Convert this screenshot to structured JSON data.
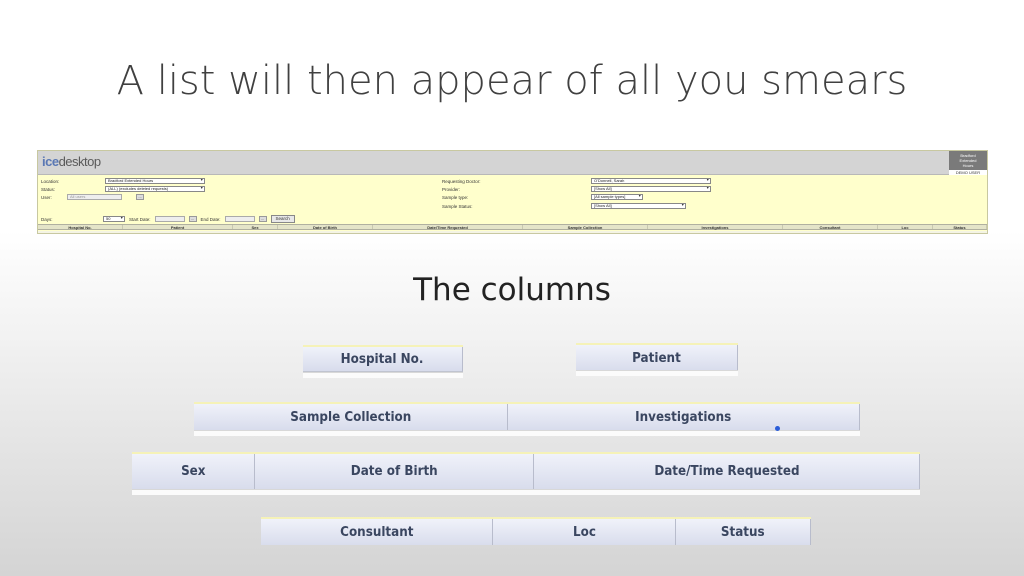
{
  "slide": {
    "title": "A list will then appear of all you smears",
    "subtitle": "The columns"
  },
  "ice": {
    "logo_part1": "ice",
    "logo_part2": "desktop",
    "user_box_lines": [
      "Bradford",
      "Extended",
      "Hours"
    ],
    "user_box_id": "DEMO USER",
    "filters": {
      "location_label": "Location:",
      "location_value": "Bradford Extended Hours",
      "status_label": "Status:",
      "status_value": "(ALL) (excludes deleted requests)",
      "user_label": "User:",
      "user_value": "All users",
      "days_label": "Days:",
      "days_value": "50",
      "start_date_label": "Start Date:",
      "end_date_label": "End Date:",
      "search_label": "Search",
      "requesting_doctor_label": "Requesting Doctor:",
      "requesting_doctor_value": "O'Donnell, Sarah",
      "provider_label": "Provider:",
      "provider_value": "[Show All]",
      "sample_type_label": "Sample type:",
      "sample_type_value": "[All sample types]",
      "sample_status_label": "Sample Status:",
      "sample_status_value": "[Show All]"
    },
    "table_headers": [
      "Hospital No.",
      "Patient",
      "Sex",
      "Date of Birth",
      "Date/Time Requested",
      "Sample Collection",
      "Investigations",
      "Consultant",
      "Loc",
      "Status"
    ]
  },
  "columns": {
    "hospital_no": "Hospital No.",
    "patient": "Patient",
    "sample_collection": "Sample Collection",
    "investigations": "Investigations",
    "sex": "Sex",
    "date_of_birth": "Date of Birth",
    "date_time_requested": "Date/Time Requested",
    "consultant": "Consultant",
    "loc": "Loc",
    "status": "Status"
  },
  "colors": {
    "panel_yellow": "#ffffcc",
    "header_text": "#3a4660",
    "logo_blue": "#5a78b4"
  }
}
